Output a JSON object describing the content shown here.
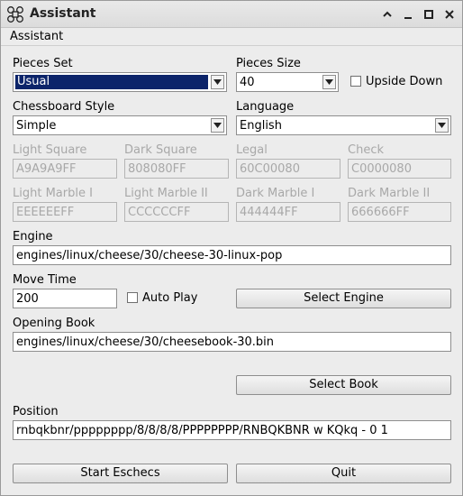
{
  "window": {
    "title": "Assistant",
    "controls": [
      "collapse",
      "minimize",
      "maximize",
      "close"
    ]
  },
  "menubar": {
    "items": [
      "Assistant"
    ]
  },
  "pieces_set": {
    "label": "Pieces Set",
    "value": "Usual"
  },
  "pieces_size": {
    "label": "Pieces Size",
    "value": "40"
  },
  "upside_down": {
    "label": "Upside Down",
    "checked": false
  },
  "chessboard_style": {
    "label": "Chessboard Style",
    "value": "Simple"
  },
  "language": {
    "label": "Language",
    "value": "English"
  },
  "colors": {
    "light_square": {
      "label": "Light Square",
      "value": "A9A9A9FF"
    },
    "dark_square": {
      "label": "Dark Square",
      "value": "808080FF"
    },
    "legal": {
      "label": "Legal",
      "value": "60C00080"
    },
    "check": {
      "label": "Check",
      "value": "C0000080"
    },
    "light_marble_1": {
      "label": "Light Marble I",
      "value": "EEEEEEFF"
    },
    "light_marble_2": {
      "label": "Light Marble II",
      "value": "CCCCCCFF"
    },
    "dark_marble_1": {
      "label": "Dark Marble I",
      "value": "444444FF"
    },
    "dark_marble_2": {
      "label": "Dark Marble II",
      "value": "666666FF"
    }
  },
  "engine": {
    "label": "Engine",
    "value": "engines/linux/cheese/30/cheese-30-linux-pop"
  },
  "move_time": {
    "label": "Move Time",
    "value": "200"
  },
  "auto_play": {
    "label": "Auto Play",
    "checked": false
  },
  "select_engine_label": "Select Engine",
  "opening_book": {
    "label": "Opening Book",
    "value": "engines/linux/cheese/30/cheesebook-30.bin"
  },
  "select_book_label": "Select Book",
  "position": {
    "label": "Position",
    "value": "rnbqkbnr/pppppppp/8/8/8/8/PPPPPPPP/RNBQKBNR w KQkq - 0 1"
  },
  "start_label": "Start Eschecs",
  "quit_label": "Quit",
  "theme": {
    "selection": "#0c246a",
    "disabled_text": "#a8a8a8"
  }
}
